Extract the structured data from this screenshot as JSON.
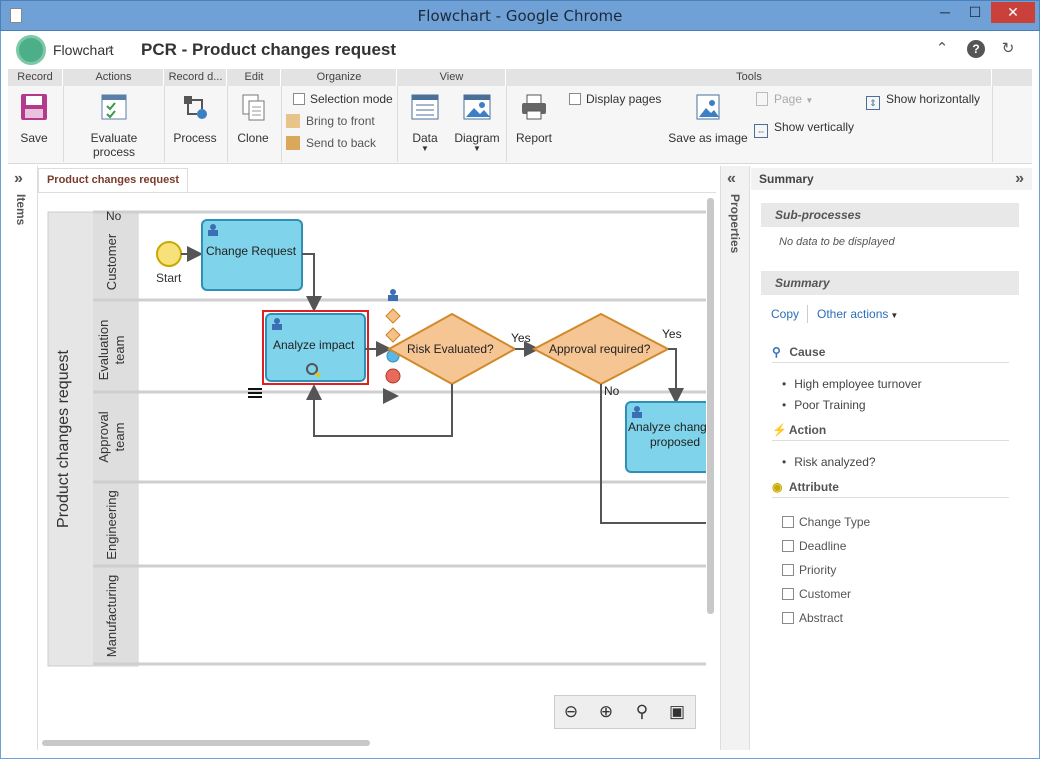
{
  "window": {
    "title": "Flowchart - Google Chrome"
  },
  "header": {
    "breadcrumb_home": "Flowchart",
    "separator": "›",
    "title": "PCR - Product changes request"
  },
  "ribbon": {
    "groups": [
      "Record",
      "Actions",
      "Record d...",
      "Edit",
      "Organize",
      "View",
      "Tools"
    ],
    "save": "Save",
    "evaluate": "Evaluate process",
    "process": "Process",
    "clone": "Clone",
    "selection_mode": "Selection mode",
    "bring_front": "Bring to front",
    "send_back": "Send to back",
    "data": "Data",
    "diagram": "Diagram",
    "report": "Report",
    "display_pages": "Display pages",
    "save_image": "Save as image",
    "page": "Page",
    "show_h": "Show horizontally",
    "show_v": "Show vertically"
  },
  "left_rail": {
    "label": "Items",
    "chevron": "»"
  },
  "tabs": [
    "Product changes request"
  ],
  "diagram": {
    "pool": "Product changes request",
    "lanes": [
      "Customer",
      "Evaluation team",
      "Approval team",
      "Engineering",
      "Manufacturing"
    ],
    "no_top": "No",
    "start_label": "Start",
    "task_change": "Change Request",
    "task_analyze": "Analyze impact",
    "gw_risk": "Risk Evaluated?",
    "gw_approval": "Approval required?",
    "yes1": "Yes",
    "yes2": "Yes",
    "no2": "No",
    "task_analyze_changes": "Analyze changes proposed",
    "task_analyze_line1": "Analyze chang",
    "task_analyze_line2": "proposed"
  },
  "props_rail": {
    "label": "Properties",
    "chevron": "«"
  },
  "summary": {
    "title": "Summary",
    "chevron": "»",
    "subprocesses_head": "Sub-processes",
    "no_data": "No data to be displayed",
    "summary_head": "Summary",
    "copy": "Copy",
    "other_actions": "Other actions",
    "cause_head": "Cause",
    "causes": [
      "High employee turnover",
      "Poor Training"
    ],
    "action_head": "Action",
    "actions": [
      "Risk analyzed?"
    ],
    "attribute_head": "Attribute",
    "attributes": [
      "Change Type",
      "Deadline",
      "Priority",
      "Customer",
      "Abstract"
    ]
  }
}
